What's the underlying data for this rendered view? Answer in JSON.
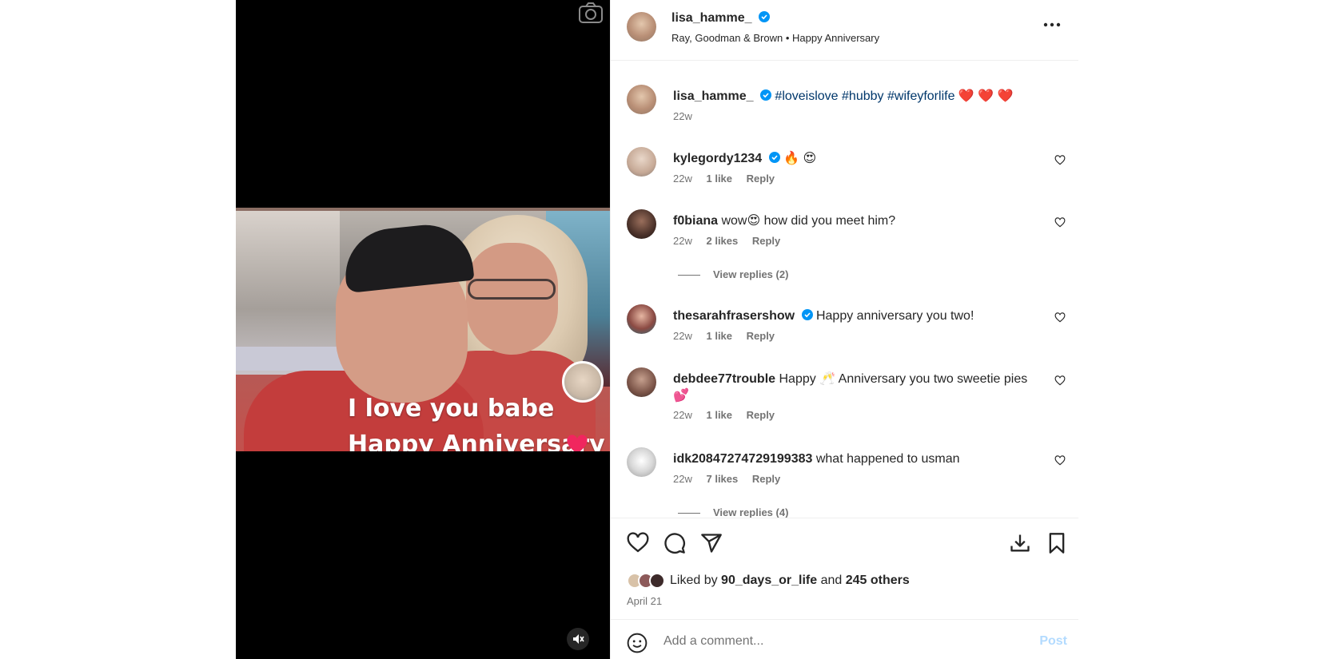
{
  "post": {
    "username": "lisa_hamme_",
    "subtitle": "Ray, Goodman & Brown • Happy Anniversary",
    "video_caption_line1": "I love you babe",
    "video_caption_line2": "Happy Anniversary",
    "caption": {
      "username": "lisa_hamme_",
      "hashtags": [
        "#loveislove",
        "#hubby",
        "#wifeyforlife"
      ],
      "emoji": "❤️ ❤️ ❤️",
      "age": "22w"
    },
    "liked_by_prefix": "Liked by",
    "liked_by_user": "90_days_or_life",
    "liked_by_and": "and",
    "liked_by_others": "245 others",
    "date": "April 21"
  },
  "comments": [
    {
      "username": "kylegordy1234",
      "verified": true,
      "text": "🔥 😍",
      "age": "22w",
      "likes": "1 like",
      "reply": "Reply"
    },
    {
      "username": "f0biana",
      "verified": false,
      "text": "wow😍  how did you meet him?",
      "age": "22w",
      "likes": "2 likes",
      "reply": "Reply",
      "view_replies": "View replies (2)"
    },
    {
      "username": "thesarahfrasershow",
      "verified": true,
      "text": "Happy anniversary you two!",
      "age": "22w",
      "likes": "1 like",
      "reply": "Reply"
    },
    {
      "username": "debdee77trouble",
      "verified": false,
      "text": "Happy 🥂 Anniversary you two sweetie pies 💕",
      "age": "22w",
      "likes": "1 like",
      "reply": "Reply"
    },
    {
      "username": "idk20847274729199383",
      "verified": false,
      "text": "what happened to usman",
      "age": "22w",
      "likes": "7 likes",
      "reply": "Reply",
      "view_replies": "View replies (4)"
    }
  ],
  "composer": {
    "placeholder": "Add a comment...",
    "post_label": "Post"
  },
  "colors": {
    "verified": "#0095f6",
    "hashtag": "#00376b",
    "heart_emoji": "#e0245e",
    "post_button_disabled": "#b3dbff"
  },
  "icons": [
    "camera-icon",
    "verified-icon",
    "more-icon",
    "heart-icon",
    "comment-icon",
    "share-icon",
    "save-icon",
    "bookmark-icon",
    "emoji-icon",
    "mute-icon"
  ]
}
